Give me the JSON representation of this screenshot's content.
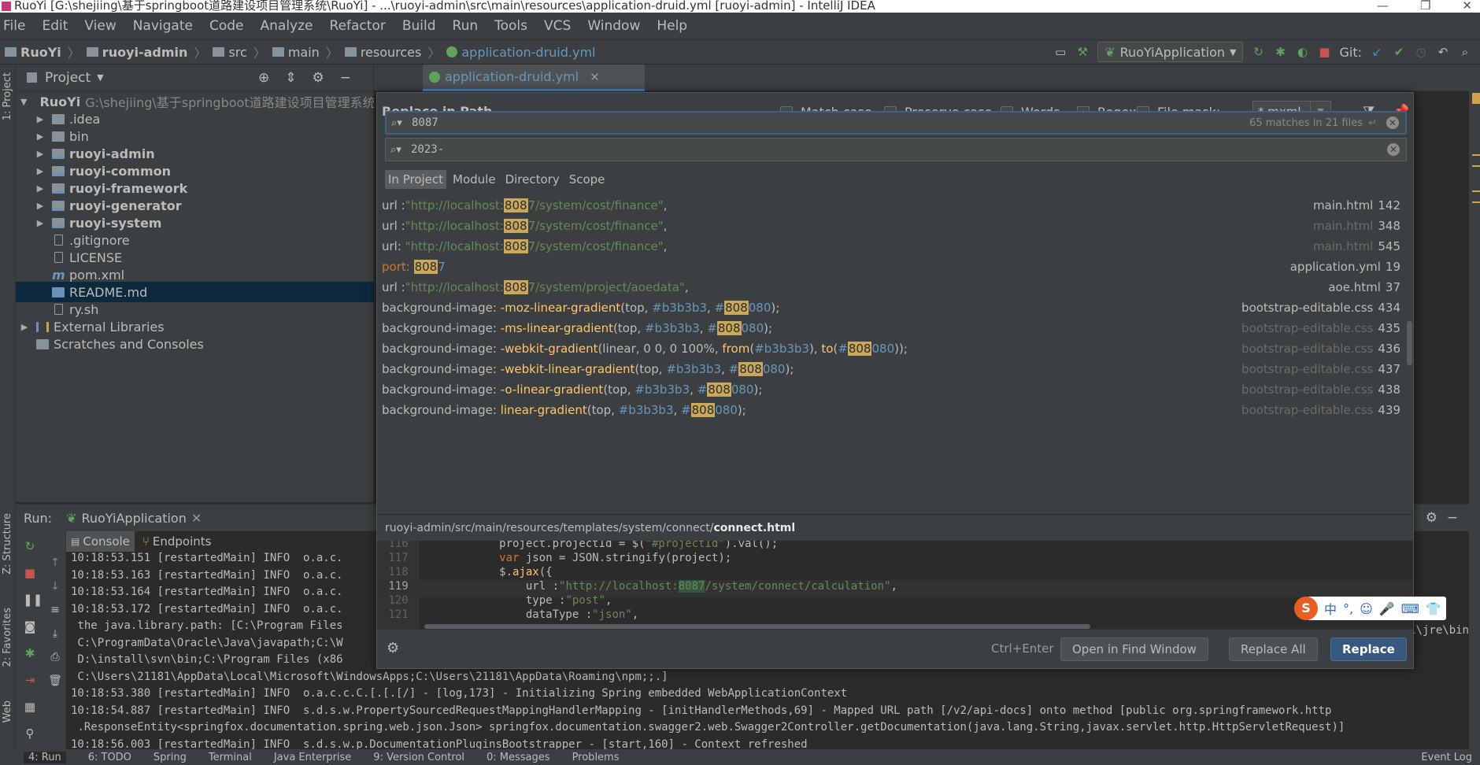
{
  "window": {
    "title": "RuoYi [G:\\shejiing\\基于springboot道路建设项目管理系统\\RuoYi] - ...\\ruoyi-admin\\src\\main\\resources\\application-druid.yml [ruoyi-admin] - IntelliJ IDEA"
  },
  "menu": [
    "File",
    "Edit",
    "View",
    "Navigate",
    "Code",
    "Analyze",
    "Refactor",
    "Build",
    "Run",
    "Tools",
    "VCS",
    "Window",
    "Help"
  ],
  "breadcrumb": [
    "RuoYi",
    "ruoyi-admin",
    "src",
    "main",
    "resources",
    "application-druid.yml"
  ],
  "toolbar": {
    "run_config": "RuoYiApplication",
    "git_label": "Git:"
  },
  "left_stripe": {
    "project": "1: Project",
    "structure": "Z: Structure",
    "favorites": "2: Favorites",
    "web": "Web"
  },
  "project_panel": {
    "title": "Project",
    "tree": [
      {
        "label": "RuoYi",
        "path": "G:\\shejiing\\基于springboot道路建设项目管理系统\\RuoYi",
        "icon": "module-folder-icon",
        "expanded": true
      },
      {
        "label": ".idea",
        "icon": "folder-icon"
      },
      {
        "label": "bin",
        "icon": "folder-icon"
      },
      {
        "label": "ruoyi-admin",
        "icon": "module-folder-icon"
      },
      {
        "label": "ruoyi-common",
        "icon": "module-folder-icon"
      },
      {
        "label": "ruoyi-framework",
        "icon": "module-folder-icon"
      },
      {
        "label": "ruoyi-generator",
        "icon": "module-folder-icon"
      },
      {
        "label": "ruoyi-system",
        "icon": "module-folder-icon"
      },
      {
        "label": ".gitignore",
        "icon": "file-icon"
      },
      {
        "label": "LICENSE",
        "icon": "file-icon"
      },
      {
        "label": "pom.xml",
        "icon": "maven-icon"
      },
      {
        "label": "README.md",
        "icon": "markdown-icon",
        "selected": true
      },
      {
        "label": "ry.sh",
        "icon": "file-icon"
      },
      {
        "label": "External Libraries",
        "icon": "library-icon"
      },
      {
        "label": "Scratches and Consoles",
        "icon": "scratches-icon"
      }
    ]
  },
  "editor": {
    "tab": "application-druid.yml"
  },
  "replace_dialog": {
    "title": "Replace in Path",
    "options": {
      "match_case": "Match case",
      "preserve_case": "Preserve case",
      "words": "Words",
      "regex": "Regex",
      "regex_help": "?",
      "file_mask": "File mask:",
      "file_mask_value": "*.mxml"
    },
    "search_value": "8087",
    "match_count": "65 matches in 21 files",
    "replace_value": "2023-",
    "scopes": [
      "In Project",
      "Module",
      "Directory",
      "Scope"
    ],
    "results": [
      {
        "text": "url :\"http://localhost:8087/system/cost/finance\",",
        "file": "main.html",
        "line": "142"
      },
      {
        "text": "url :\"http://localhost:8087/system/cost/finance\",",
        "file": "main.html",
        "line": "348"
      },
      {
        "text": "url: \"http://localhost:8087/system/cost/finance\",",
        "file": "main.html",
        "line": "545"
      },
      {
        "text": "port: 8087",
        "file": "application.yml",
        "line": "19"
      },
      {
        "text": "url :\"http://localhost:8087/system/project/aoedata\",",
        "file": "aoe.html",
        "line": "37"
      },
      {
        "text": "background-image: -moz-linear-gradient(top, #b3b3b3, #808080);",
        "file": "bootstrap-editable.css",
        "line": "434"
      },
      {
        "text": "background-image: -ms-linear-gradient(top, #b3b3b3, #808080);",
        "file": "bootstrap-editable.css",
        "line": "435"
      },
      {
        "text": "background-image: -webkit-gradient(linear, 0 0, 0 100%, from(#b3b3b3), to(#808080));",
        "file": "bootstrap-editable.css",
        "line": "436"
      },
      {
        "text": "background-image: -webkit-linear-gradient(top, #b3b3b3, #808080);",
        "file": "bootstrap-editable.css",
        "line": "437"
      },
      {
        "text": "background-image: -o-linear-gradient(top, #b3b3b3, #808080);",
        "file": "bootstrap-editable.css",
        "line": "438"
      },
      {
        "text": "background-image: linear-gradient(top, #b3b3b3, #808080);",
        "file": "bootstrap-editable.css",
        "line": "439"
      }
    ],
    "preview_path": "ruoyi-admin/src/main/resources/templates/system/connect/",
    "preview_file": "connect.html",
    "preview_lines": [
      {
        "n": "116",
        "code": "            project.projectId = $(\"#projectId\").val();"
      },
      {
        "n": "117",
        "code": "            var json = JSON.stringify(project);"
      },
      {
        "n": "118",
        "code": "            $.ajax({"
      },
      {
        "n": "119",
        "code": "                url :\"http://localhost:8087/system/connect/calculation\","
      },
      {
        "n": "120",
        "code": "                type :\"post\","
      },
      {
        "n": "121",
        "code": "                dataType :\"json\","
      }
    ],
    "shortcut": "Ctrl+Enter",
    "buttons": {
      "open_in_find": "Open in Find Window",
      "replace_all": "Replace All",
      "replace": "Replace"
    }
  },
  "run_panel": {
    "label": "Run:",
    "tab": "RuoYiApplication",
    "console_tab": "Console",
    "endpoints_tab": "Endpoints",
    "lines": [
      "10:18:53.151 [restartedMain] INFO  o.a.c.",
      "10:18:53.163 [restartedMain] INFO  o.a.c.",
      "10:18:53.164 [restartedMain] INFO  o.a.c.",
      "10:18:53.172 [restartedMain] INFO  o.a.c.",
      " the java.library.path: [C:\\Program Files",
      " C:\\ProgramData\\Oracle\\Java\\javapath;C:\\W",
      " D:\\install\\svn\\bin;C:\\Program Files (x86",
      " C:\\Users\\21181\\AppData\\Local\\Microsoft\\WindowsApps;C:\\Users\\21181\\AppData\\Roaming\\npm;;.]",
      "10:18:53.380 [restartedMain] INFO  o.a.c.c.C.[.[.[/] - [log,173] - Initializing Spring embedded WebApplicationContext",
      "10:18:54.887 [restartedMain] INFO  s.d.s.w.PropertySourcedRequestMappingHandlerMapping - [initHandlerMethods,69] - Mapped URL path [/v2/api-docs] onto method [public org.springframework.http",
      " .ResponseEntity<springfox.documentation.spring.web.json.Json> springfox.documentation.swagger2.web.Swagger2Controller.getDocumentation(java.lang.String,javax.servlet.http.HttpServletRequest)]",
      "10:18:56.003 [restartedMain] INFO  s.d.s.w.p.DocumentationPluginsBootstrapper - [start,160] - Context refreshed"
    ],
    "right_fragment": "91\\jre\\bin"
  },
  "bottom_bar": [
    "4: Run",
    "6: TODO",
    "Spring",
    "Terminal",
    "Java Enterprise",
    "9: Version Control",
    "0: Messages",
    "Problems",
    "Event Log"
  ],
  "ime": {
    "items": [
      "中",
      "°,",
      "☺",
      "🎤",
      "⌨",
      "👕"
    ]
  },
  "colors": {
    "background": "#2b2b2b",
    "panel": "#3c3f41",
    "accent": "#4a88c7",
    "match_highlight": "#c9a75b",
    "string": "#6a8759",
    "keyword": "#cc7832",
    "number": "#6897bb",
    "primary_button": "#365880"
  }
}
